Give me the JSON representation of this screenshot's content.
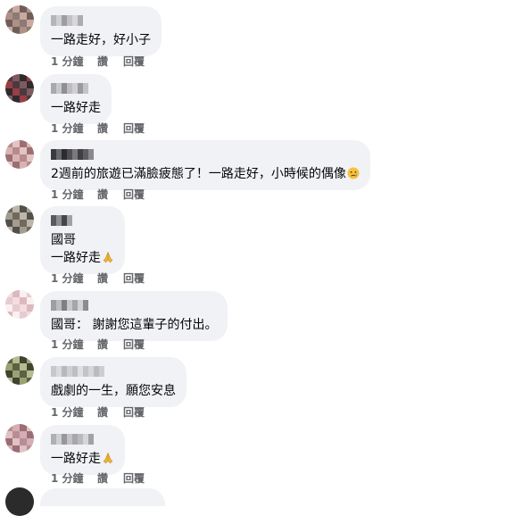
{
  "comments": [
    {
      "lines": [
        "一路走好，好小子"
      ],
      "meta": {
        "time": "1 分鐘",
        "like": "讚",
        "reply": "回覆"
      },
      "avatar_colors": [
        "#8a7b74",
        "#b08f86",
        "#6d5f58",
        "#c9a9a0"
      ],
      "name_colors": [
        "#b5b5b8",
        "#cfcfd2",
        "#9e9ea2",
        "#c2c2c5",
        "#d7d7da",
        "#adadb0"
      ]
    },
    {
      "lines": [
        "一路好走"
      ],
      "meta": {
        "time": "1 分鐘",
        "like": "讚",
        "reply": "回覆"
      },
      "avatar_colors": [
        "#4a3a3e",
        "#9a3d45",
        "#2f2a2c",
        "#7c5b61"
      ],
      "name_colors": [
        "#a9a9ac",
        "#c8c8cb",
        "#8f8f93",
        "#bdbdc0",
        "#d0d0d3",
        "#9b9b9e",
        "#c4c4c7"
      ]
    },
    {
      "lines": [
        "2週前的旅遊已滿臉疲態了！一路走好，小時候的偶像"
      ],
      "emoji": "crying-face",
      "meta": {
        "time": "1 分鐘",
        "like": "讚",
        "reply": "回覆"
      },
      "avatar_colors": [
        "#b78a8c",
        "#d9b3b3",
        "#9c6f72",
        "#e2c4c4"
      ],
      "name_colors": [
        "#3b3b3e",
        "#6a6a6e",
        "#2c2c2f",
        "#4f4f53",
        "#7a7a7e",
        "#3f3f42",
        "#5e5e62",
        "#8a8a8e"
      ]
    },
    {
      "lines": [
        "國哥",
        "一路好走"
      ],
      "emoji": "folded-hands",
      "meta": {
        "time": "1 分鐘",
        "like": "讚",
        "reply": "回覆"
      },
      "avatar_colors": [
        "#6f6a5f",
        "#a39c8f",
        "#51504a",
        "#bdb6a8"
      ],
      "name_colors": [
        "#5a5a5e",
        "#8e8e92",
        "#46464a",
        "#a2a2a6"
      ]
    },
    {
      "lines": [
        "國哥： 謝謝您這輩子的付出。"
      ],
      "meta": {
        "time": "1 分鐘",
        "like": "讚",
        "reply": "回覆"
      },
      "avatar_colors": [
        "#f2dde0",
        "#e8cbd0",
        "#faf0f2",
        "#dcb9be"
      ],
      "name_colors": [
        "#9e9ea2",
        "#bdbdc0",
        "#7f7f83",
        "#c9c9cc",
        "#a6a6a9",
        "#d3d3d6",
        "#8c8c90"
      ]
    },
    {
      "lines": [
        "戲劇的一生，願您安息"
      ],
      "meta": {
        "time": "1 分鐘",
        "like": "讚",
        "reply": "回覆"
      },
      "avatar_colors": [
        "#5b6141",
        "#9aa173",
        "#3f4430",
        "#b6ba92"
      ],
      "name_colors": [
        "#c8c8cc",
        "#dadade",
        "#b8b8bc",
        "#d0d0d4",
        "#bfbfc3",
        "#e0e0e4",
        "#c4c4c8",
        "#d6d6da",
        "#bbbbbf",
        "#cdcdd1"
      ]
    },
    {
      "lines": [
        "一路好走"
      ],
      "emoji": "folded-hands",
      "meta": {
        "time": "1 分鐘",
        "like": "讚",
        "reply": "回覆"
      },
      "avatar_colors": [
        "#b88d93",
        "#e0c2c6",
        "#9a6e75",
        "#d4aeb3"
      ],
      "name_colors": [
        "#b0b0b4",
        "#cfcfd3",
        "#98989c",
        "#c3c3c7",
        "#a8a8ac",
        "#bababe",
        "#d6d6da",
        "#a2a2a6"
      ]
    }
  ]
}
